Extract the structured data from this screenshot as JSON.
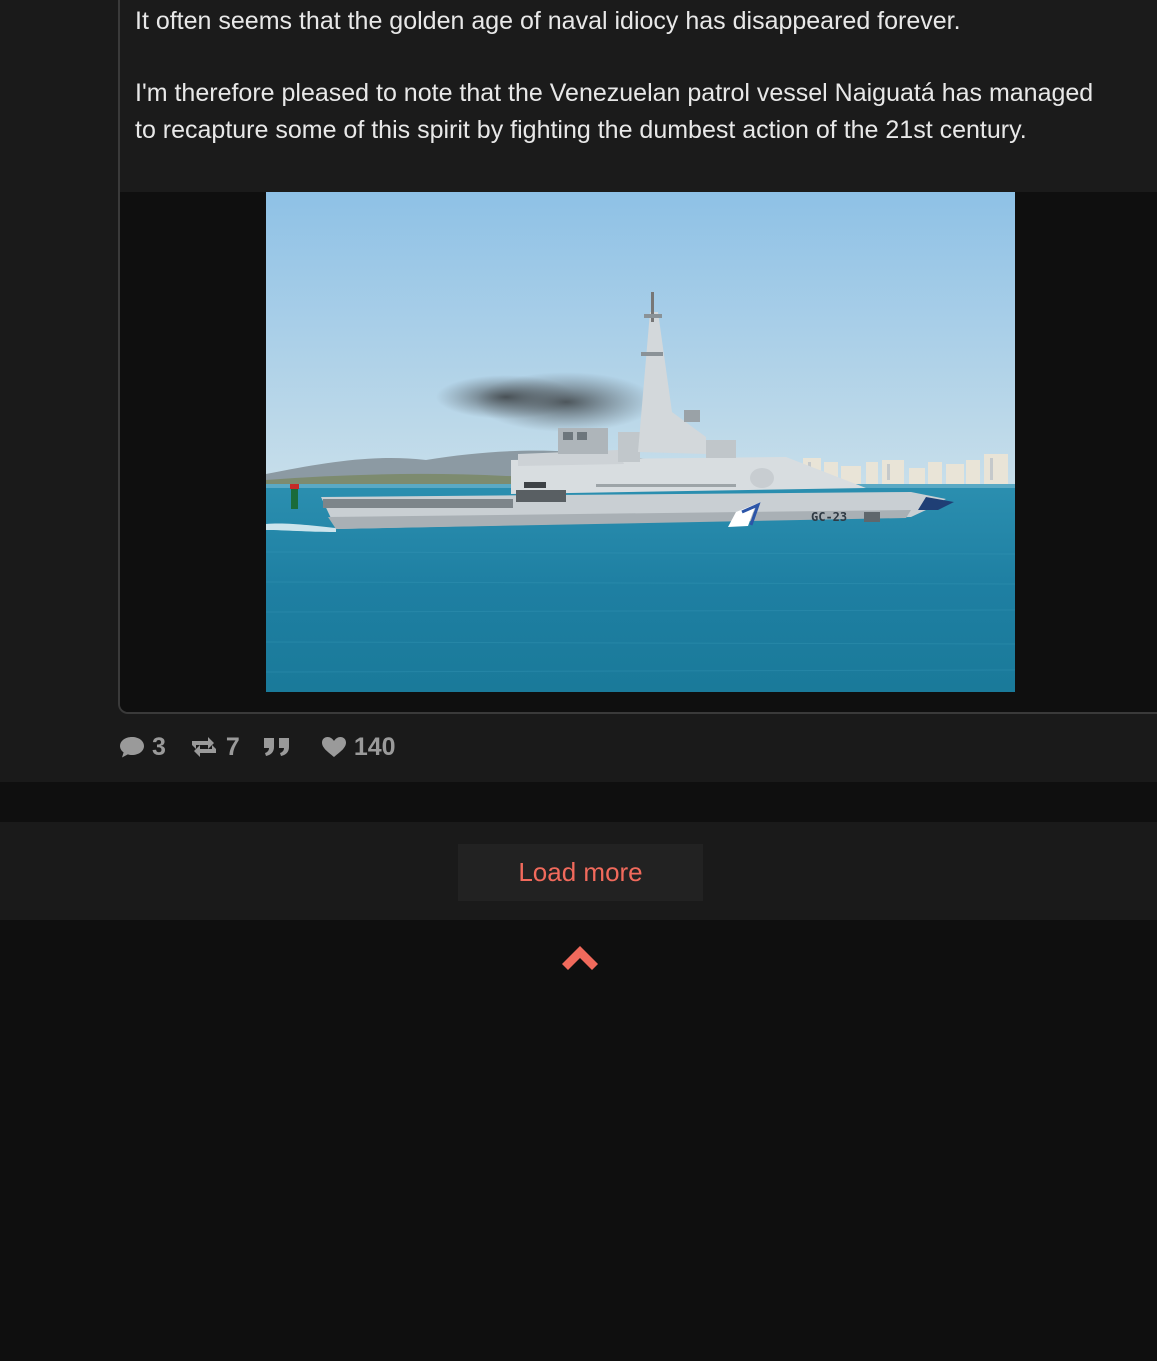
{
  "post": {
    "paragraphs": [
      "It often seems that the golden age of naval idiocy has disappeared forever.",
      "I'm therefore pleased to note that the Venezuelan patrol vessel Naiguatá has managed to recapture some of this spirit by fighting the dumbest action of the 21st century."
    ],
    "image": {
      "hull_marking": "GC-23"
    }
  },
  "stats": {
    "replies": "3",
    "reblogs": "7",
    "quote_icon": "quote-icon",
    "likes": "140"
  },
  "icons": {
    "replies": "comment-bubble-icon",
    "reblogs": "reblog-icon",
    "quote": "quote-icon",
    "likes": "heart-icon",
    "scroll_top": "chevron-up-icon"
  },
  "load_more": {
    "label": "Load more"
  },
  "colors": {
    "accent": "#f16a5c",
    "background": "#0f0f0f",
    "panel": "#1a1a1a",
    "muted": "#9a9a9a"
  }
}
